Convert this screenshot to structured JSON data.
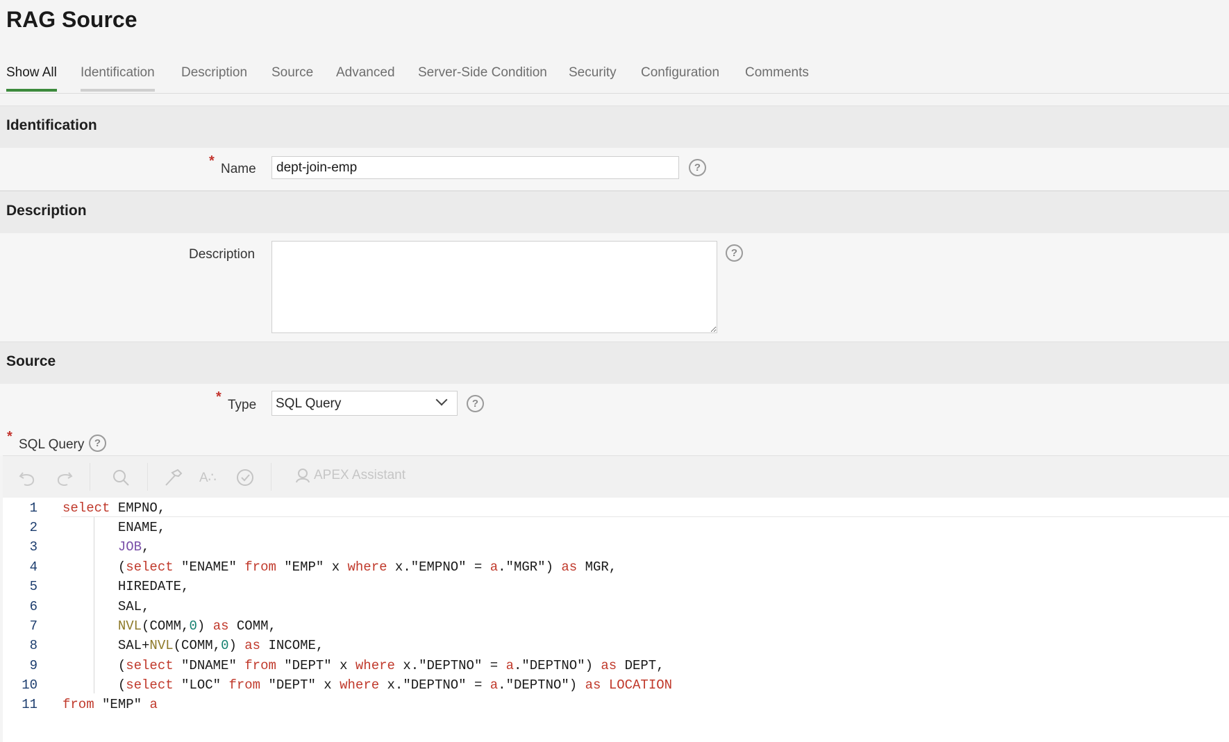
{
  "page": {
    "title": "RAG Source"
  },
  "tabs": [
    {
      "label": "Show All",
      "active": true
    },
    {
      "label": "Identification"
    },
    {
      "label": "Description"
    },
    {
      "label": "Source"
    },
    {
      "label": "Advanced"
    },
    {
      "label": "Server-Side Condition"
    },
    {
      "label": "Security"
    },
    {
      "label": "Configuration"
    },
    {
      "label": "Comments"
    }
  ],
  "identification": {
    "heading": "Identification",
    "name_label": "Name",
    "name_value": "dept-join-emp",
    "required_mark": "*"
  },
  "description": {
    "heading": "Description",
    "label": "Description",
    "value": ""
  },
  "source": {
    "heading": "Source",
    "type_label": "Type",
    "type_value": "SQL Query",
    "sql_label": "SQL Query"
  },
  "toolbar": {
    "assistant_label": "APEX Assistant",
    "icons": [
      "undo-icon",
      "redo-icon",
      "search-icon",
      "hammer-icon",
      "format-icon",
      "validate-icon",
      "assistant-icon"
    ]
  },
  "help_glyph": "?",
  "code": {
    "line_numbers": [
      "1",
      "2",
      "3",
      "4",
      "5",
      "6",
      "7",
      "8",
      "9",
      "10",
      "11"
    ],
    "lines": [
      "select EMPNO,",
      "       ENAME,",
      "       JOB,",
      "       (select \"ENAME\" from \"EMP\" x where x.\"EMPNO\" = a.\"MGR\") as MGR,",
      "       HIREDATE,",
      "       SAL,",
      "       NVL(COMM,0) as COMM,",
      "       SAL+NVL(COMM,0) as INCOME,",
      "       (select \"DNAME\" from \"DEPT\" x where x.\"DEPTNO\" = a.\"DEPTNO\") as DEPT,",
      "       (select \"LOC\" from \"DEPT\" x where x.\"DEPTNO\" = a.\"DEPTNO\") as LOCATION",
      "from \"EMP\" a"
    ]
  },
  "colors": {
    "accent_tab": "#3c8a3c",
    "required": "#c3352e",
    "keyword": "#c0392b",
    "function": "#8e7a2a",
    "number": "#13806f"
  }
}
